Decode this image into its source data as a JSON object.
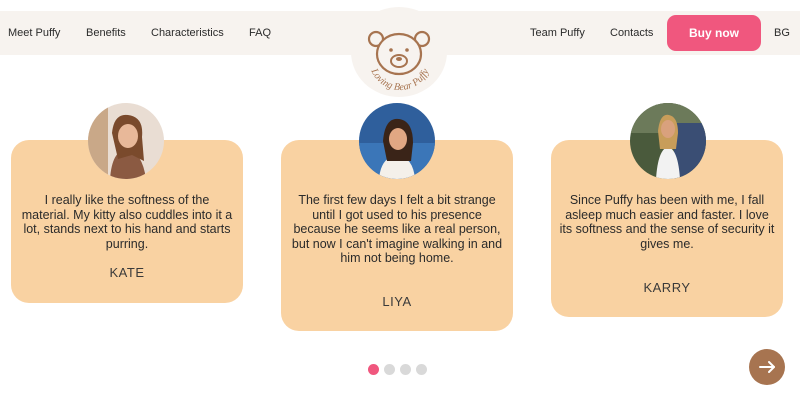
{
  "nav": {
    "left_links": [
      "Meet Puffy",
      "Benefits",
      "Characteristics",
      "FAQ"
    ],
    "right_links": [
      "Team Puffy",
      "Contacts"
    ],
    "buy_label": "Buy now",
    "language": "BG"
  },
  "logo": {
    "text": "Loving Bear Puffy",
    "icon": "bear-icon"
  },
  "testimonials": [
    {
      "quote": "I really like the softness of the material. My kitty also cuddles into it a lot, stands next to his hand and starts purring.",
      "author": "KATE"
    },
    {
      "quote": "The first few days I felt a bit strange until I got used to his presence because he seems like a real person, but now I can't imagine walking in and him not being home.",
      "author": "LIYA"
    },
    {
      "quote": "Since Puffy has been with me, I fall asleep much easier and faster. I love its softness and the sense of security it gives me.",
      "author": "KARRY"
    }
  ],
  "carousel": {
    "total_dots": 4,
    "active_dot": 1,
    "next_icon": "arrow-right-icon"
  },
  "colors": {
    "accent": "#f0577e",
    "card": "#f9d2a2",
    "nav_bg": "#f7f3ef",
    "brown": "#a77450"
  }
}
